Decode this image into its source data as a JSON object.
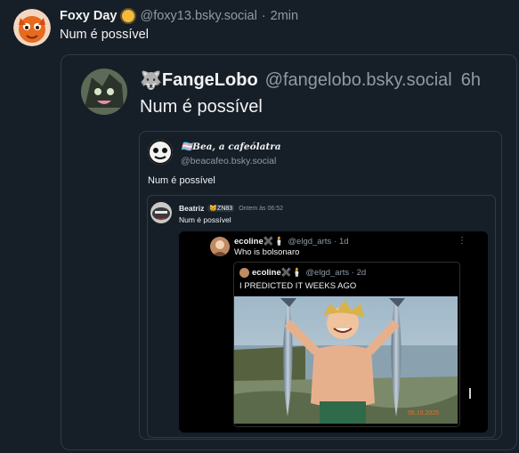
{
  "post": {
    "author_name": "Foxy Day",
    "badge_icon": "sun-badge-icon",
    "handle": "@foxy13.bsky.social",
    "separator": "·",
    "time": "2min",
    "text": "Num é possível"
  },
  "quote1": {
    "author_emoji": "🐺",
    "author_name": "FangeLobo",
    "handle": "@fangelobo.bsky.social",
    "time": "6h",
    "text": "Num é possível"
  },
  "quote2": {
    "author_name": "🏳️‍⚧️Bea, a cafeólatra",
    "handle": "@beacafeo.bsky.social",
    "text": "Num é possível"
  },
  "quote3": {
    "author_name": "Beatriz",
    "badge": "😸ZN83",
    "time": "Ontem às 06:52",
    "text": "Num é possível"
  },
  "quote4": {
    "author_name": "ecoline✖️🕯️",
    "handle": "@elgd_arts",
    "time": "· 1d",
    "text": "Who is bolsonaro",
    "menu": "⋮"
  },
  "quote5": {
    "author_name": "ecoline✖️🕯️",
    "handle": "@elgd_arts · 2d",
    "text": "I PREDICTED IT WEEKS AGO",
    "image_date": "05.10.2025"
  },
  "colors": {
    "background": "#161e27",
    "border": "#2f3a46",
    "muted": "#8f9aa7"
  }
}
